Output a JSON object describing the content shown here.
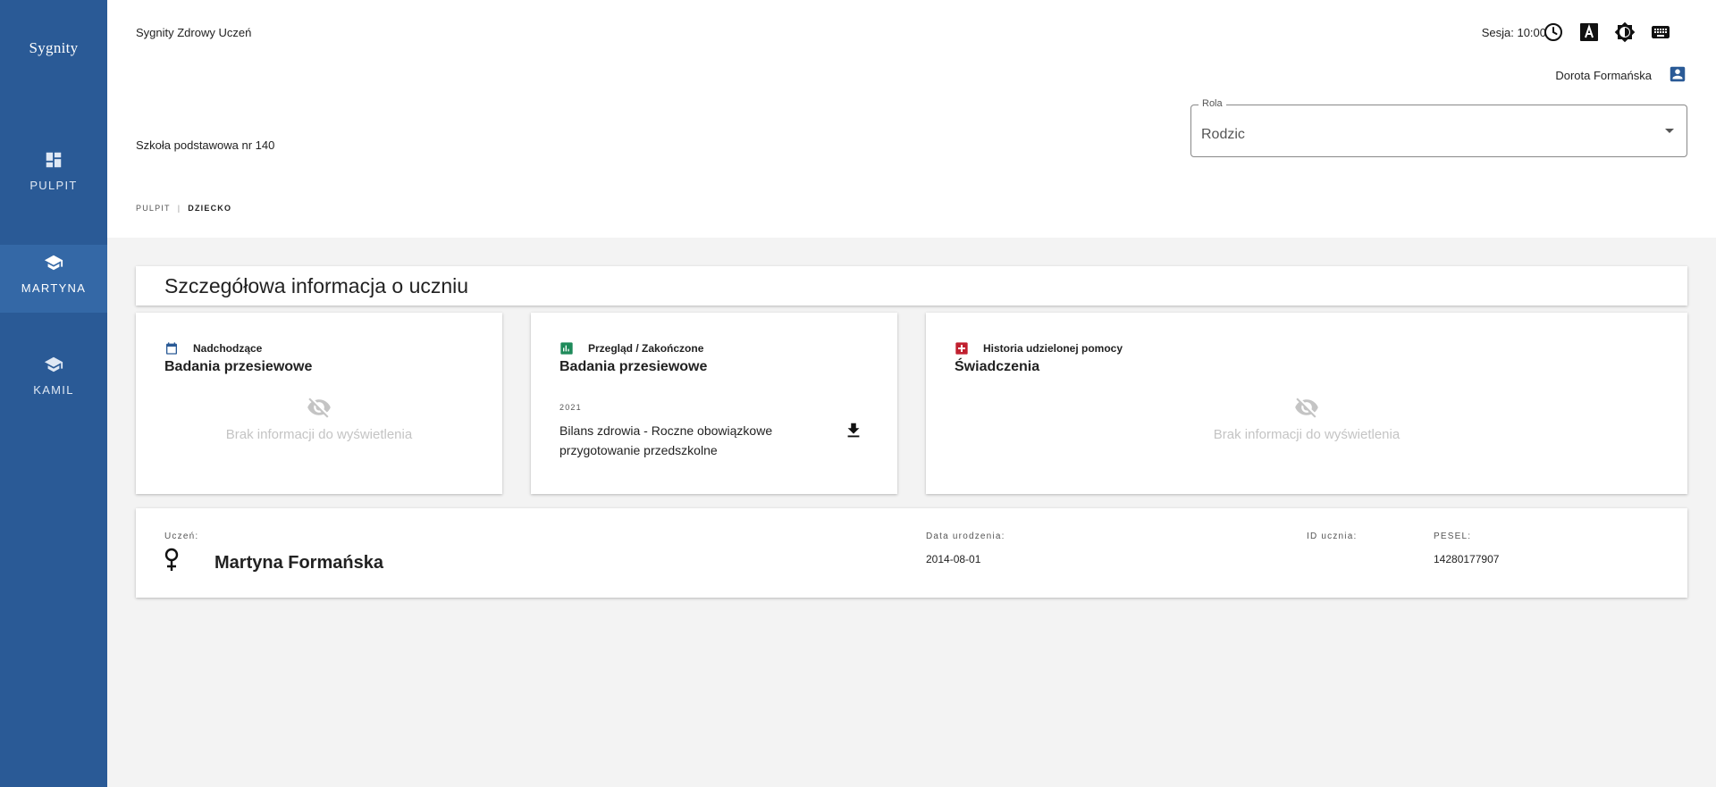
{
  "app": {
    "logo": "Sygnity",
    "title": "Sygnity Zdrowy Uczeń",
    "session": "Sesja: 10:00",
    "user_name": "Dorota Formańska",
    "school": "Szkoła podstawowa nr 140"
  },
  "sidebar": {
    "items": [
      {
        "label": "PULPIT",
        "icon": "dashboard-icon"
      },
      {
        "label": "MARTYNA",
        "icon": "school-icon",
        "active": true
      },
      {
        "label": "KAMIL",
        "icon": "school-icon"
      }
    ]
  },
  "role": {
    "label": "Rola",
    "value": "Rodzic"
  },
  "breadcrumb": {
    "items": [
      "PULPIT",
      "DZIECKO"
    ]
  },
  "section_title": "Szczegółowa informacja o uczniu",
  "tiles": [
    {
      "header": "Nadchodzące",
      "title": "Badania przesiewowe",
      "empty_text": "Brak informacji do wyświetlenia",
      "icon_color": "#2a5a96"
    },
    {
      "header": "Przegląd / Zakończone",
      "title": "Badania przesiewowe",
      "year": "2021",
      "entry": "Bilans zdrowia - Roczne obowiązkowe przygotowanie przedszkolne",
      "icon_color": "#1e8a5a"
    },
    {
      "header": "Historia udzielonej pomocy",
      "title": "Świadczenia",
      "empty_text": "Brak informacji do wyświetlenia",
      "icon_color": "#c0202f"
    }
  ],
  "student": {
    "name_label": "Uczeń:",
    "name": "Martyna Formańska",
    "birth_label": "Data urodzenia:",
    "birth": "2014-08-01",
    "id_label": "ID ucznia:",
    "id": "",
    "pesel_label": "PESEL:",
    "pesel": "14280177907"
  },
  "colors": {
    "sidebar": "#2a5a96",
    "sidebar_active": "#3468a6",
    "background": "#f3f3f3"
  }
}
